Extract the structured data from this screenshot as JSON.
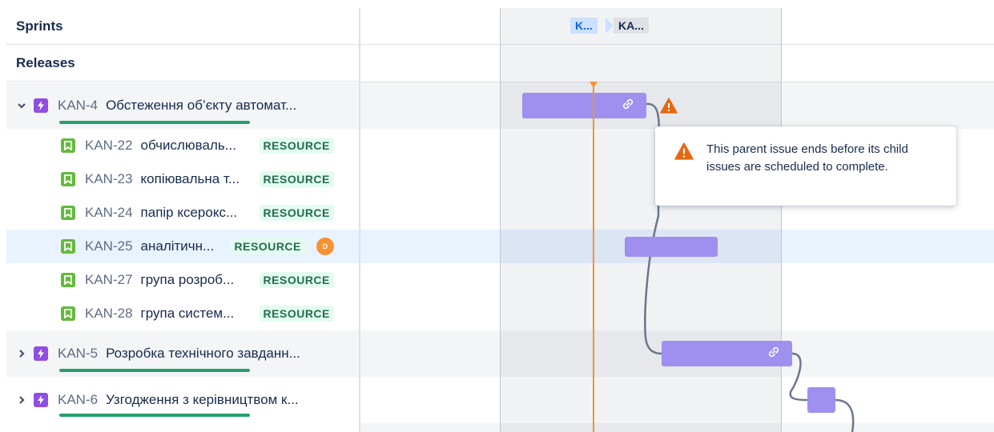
{
  "header": {
    "sprints_label": "Sprints",
    "releases_label": "Releases"
  },
  "sprint_chips": [
    "K...",
    "KA..."
  ],
  "issues": [
    {
      "key": "KAN-4",
      "title": "Обстеження об’єкту автомат...",
      "type": "epic",
      "expanded": true
    },
    {
      "key": "KAN-22",
      "title": "обчислюваль...",
      "type": "story",
      "label": "RESOURCE"
    },
    {
      "key": "KAN-23",
      "title": "копіювальна т...",
      "type": "story",
      "label": "RESOURCE"
    },
    {
      "key": "KAN-24",
      "title": "папір ксерокс...",
      "type": "story",
      "label": "RESOURCE"
    },
    {
      "key": "KAN-25",
      "title": "аналітичн...",
      "type": "story",
      "label": "RESOURCE",
      "assignee": "D",
      "selected": true
    },
    {
      "key": "KAN-27",
      "title": "група розроб...",
      "type": "story",
      "label": "RESOURCE"
    },
    {
      "key": "KAN-28",
      "title": "група систем...",
      "type": "story",
      "label": "RESOURCE"
    },
    {
      "key": "KAN-5",
      "title": "Розробка технічного завданн...",
      "type": "epic",
      "expanded": false
    },
    {
      "key": "KAN-6",
      "title": "Узгодження з керівництвом к...",
      "type": "epic",
      "expanded": false
    }
  ],
  "tooltip": {
    "text": "This parent issue ends before its child issues are scheduled to complete."
  },
  "icons": {
    "expand": "chevron-down-icon",
    "collapse": "chevron-right-icon",
    "epic": "lightning-icon",
    "story": "bookmark-icon",
    "link": "link-icon",
    "warning": "warning-icon"
  },
  "colors": {
    "epic": "#904ee2",
    "story": "#63ba3c",
    "bar": "#9f8fef",
    "today": "#f79232",
    "warning": "#e56910",
    "progress": "#22a06b",
    "lozenge_bg": "#e3fcef",
    "lozenge_text": "#216e4e"
  }
}
